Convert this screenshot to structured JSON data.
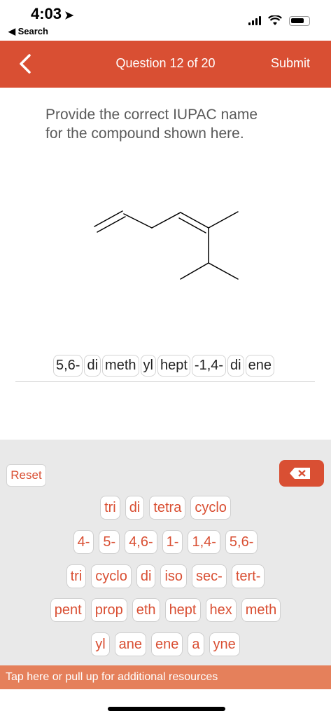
{
  "status": {
    "time": "4:03",
    "back_label": "◀ Search"
  },
  "header": {
    "title": "Question 12 of 20",
    "submit_label": "Submit"
  },
  "prompt": {
    "line1": "Provide the correct IUPAC name",
    "line2": "for the compound shown here."
  },
  "answer": {
    "chips": [
      "5,6-",
      "di",
      "meth",
      "yl",
      "hept",
      "-1,4-",
      "di",
      "ene"
    ]
  },
  "keyboard": {
    "reset_label": "Reset",
    "rows": [
      [
        "tri",
        "di",
        "tetra",
        "cyclo"
      ],
      [
        "4-",
        "5-",
        "4,6-",
        "1-",
        "1,4-",
        "5,6-"
      ],
      [
        "tri",
        "cyclo",
        "di",
        "iso",
        "sec-",
        "tert-"
      ],
      [
        "pent",
        "prop",
        "eth",
        "hept",
        "hex",
        "meth"
      ],
      [
        "yl",
        "ane",
        "ene",
        "a",
        "yne"
      ]
    ]
  },
  "resources": {
    "label": "Tap here or pull up for additional resources"
  },
  "colors": {
    "accent": "#d94f33",
    "resources_bar": "#e5805b",
    "keyboard_bg": "#e9e9e9"
  }
}
